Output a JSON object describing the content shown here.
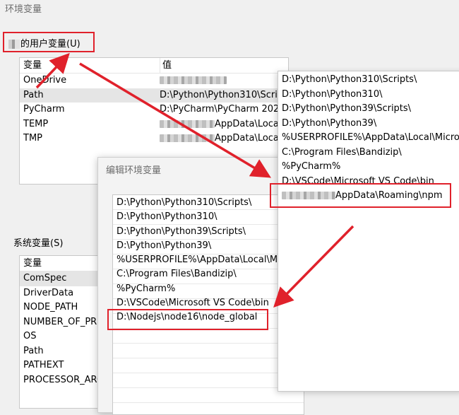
{
  "window": {
    "title": "环境变量"
  },
  "user_vars": {
    "title": "的用户变量(U)",
    "col_name": "变量",
    "col_value": "值",
    "rows": [
      {
        "name": "OneDrive",
        "value": ""
      },
      {
        "name": "Path",
        "value": "D:\\Python\\Python310\\Scrip"
      },
      {
        "name": "PyCharm",
        "value": "D:\\PyCharm\\PyCharm 202"
      },
      {
        "name": "TEMP",
        "value": "AppData\\Local"
      },
      {
        "name": "TMP",
        "value": "AppData\\Local"
      }
    ]
  },
  "system_vars": {
    "title": "系统变量(S)",
    "col_name": "变量",
    "rows": [
      "ComSpec",
      "DriverData",
      "NODE_PATH",
      "NUMBER_OF_PRO",
      "OS",
      "Path",
      "PATHEXT",
      "PROCESSOR_ARC"
    ]
  },
  "edit_dialog": {
    "title": "编辑环境变量",
    "entries": [
      "D:\\Python\\Python310\\Scripts\\",
      "D:\\Python\\Python310\\",
      "D:\\Python\\Python39\\Scripts\\",
      "D:\\Python\\Python39\\",
      "%USERPROFILE%\\AppData\\Local\\M",
      "C:\\Program Files\\Bandizip\\",
      "%PyCharm%",
      "D:\\VSCode\\Microsoft VS Code\\bin",
      "D:\\Nodejs\\node16\\node_global"
    ]
  },
  "popup": {
    "entries": [
      "D:\\Python\\Python310\\Scripts\\",
      "D:\\Python\\Python310\\",
      "D:\\Python\\Python39\\Scripts\\",
      "D:\\Python\\Python39\\",
      "%USERPROFILE%\\AppData\\Local\\Micros",
      "C:\\Program Files\\Bandizip\\",
      "%PyCharm%",
      "D:\\VSCode\\Microsoft VS Code\\bin",
      "AppData\\Roaming\\npm"
    ]
  },
  "colors": {
    "annotation_red": "#e0212b"
  }
}
